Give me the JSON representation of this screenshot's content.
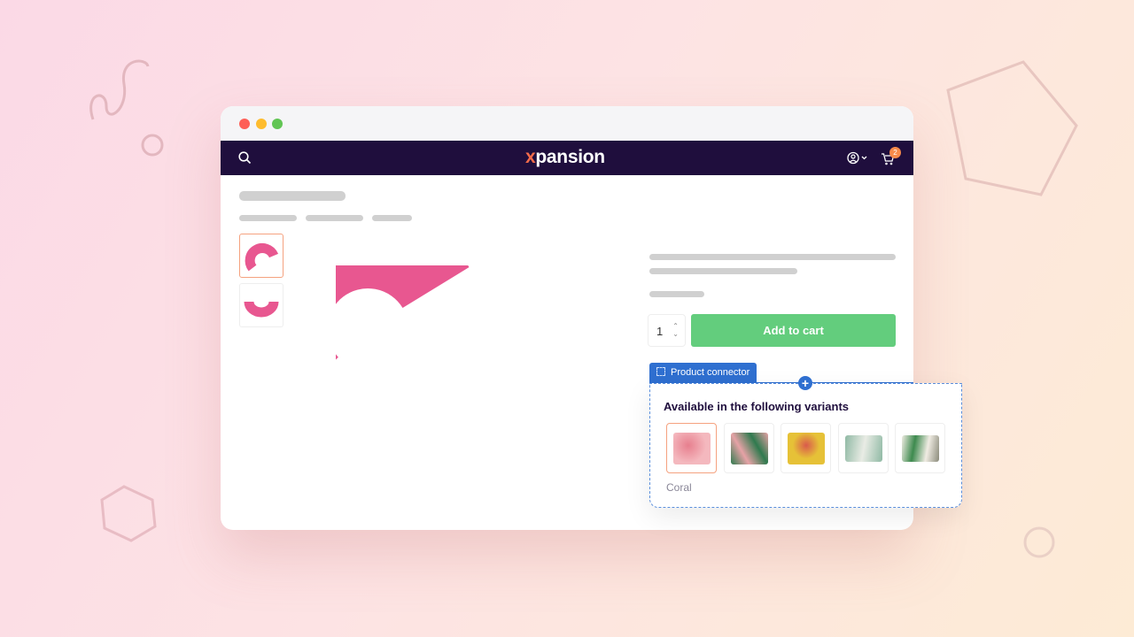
{
  "window": {
    "traffic_lights": [
      "#fe5f57",
      "#febc2e",
      "#61c554"
    ]
  },
  "nav": {
    "logo_x": "x",
    "logo_rest": "pansion",
    "cart_count": "2"
  },
  "product": {
    "quantity": "1",
    "add_to_cart": "Add to cart",
    "accent_color": "#e85790"
  },
  "connector": {
    "tab_label": "Product connector",
    "title": "Available in the following variants",
    "selected_variant": "Coral",
    "variants": [
      {
        "colors": [
          "#f4b8be",
          "#e77f8e"
        ]
      },
      {
        "colors": [
          "#2f7a4e",
          "#e6a2a6"
        ]
      },
      {
        "colors": [
          "#e6c137",
          "#d95a4c"
        ]
      },
      {
        "colors": [
          "#8fb9a4",
          "#e9ece5"
        ]
      },
      {
        "colors": [
          "#f0ece3",
          "#3d8a4e"
        ]
      }
    ]
  }
}
